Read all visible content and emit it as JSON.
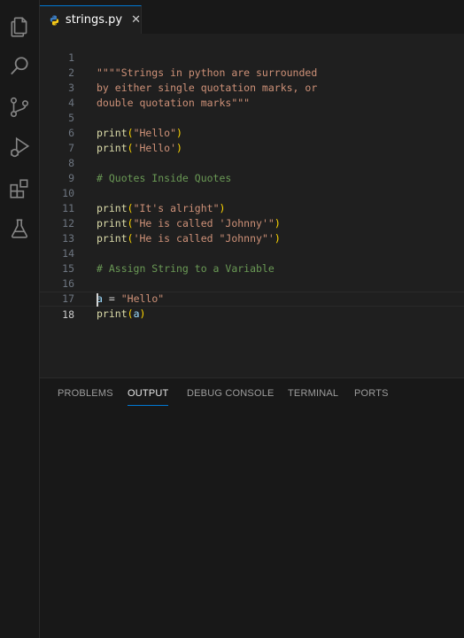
{
  "activity_bar": {
    "icons": [
      "files-icon",
      "search-icon",
      "source-control-icon",
      "run-debug-icon",
      "extensions-icon",
      "testing-icon"
    ]
  },
  "tab": {
    "filename": "strings.py",
    "close": "✕"
  },
  "editor": {
    "line_numbers": [
      "1",
      "2",
      "3",
      "4",
      "5",
      "6",
      "7",
      "8",
      "9",
      "10",
      "11",
      "12",
      "13",
      "14",
      "15",
      "16",
      "17",
      "18"
    ],
    "current_line": "18",
    "lines": {
      "l1": "\"\"\"\"Strings in python are surrounded",
      "l2": "by either single quotation marks, or",
      "l3": "double quotation marks\"\"\"",
      "l5_fn": "print",
      "l5_arg": "\"Hello\"",
      "l6_fn": "print",
      "l6_arg": "'Hello'",
      "l8": "# Quotes Inside Quotes",
      "l10_fn": "print",
      "l10_arg": "\"It's alright\"",
      "l11_fn": "print",
      "l11_arg": "\"He is called 'Johnny'\"",
      "l12_fn": "print",
      "l12_arg": "'He is called \"Johnny\"'",
      "l14": "# Assign String to a Variable",
      "l16_var": "a",
      "l16_op": " = ",
      "l16_val": "\"Hello\"",
      "l17_fn": "print",
      "l17_arg": "a"
    }
  },
  "panel": {
    "tabs": [
      "PROBLEMS",
      "OUTPUT",
      "DEBUG CONSOLE",
      "TERMINAL",
      "PORTS"
    ],
    "active_tab": "OUTPUT"
  },
  "colors": {
    "accent": "#0078d4",
    "string": "#ce9178",
    "function": "#dcdcaa",
    "comment": "#6a9955",
    "variable": "#9cdcfe"
  }
}
